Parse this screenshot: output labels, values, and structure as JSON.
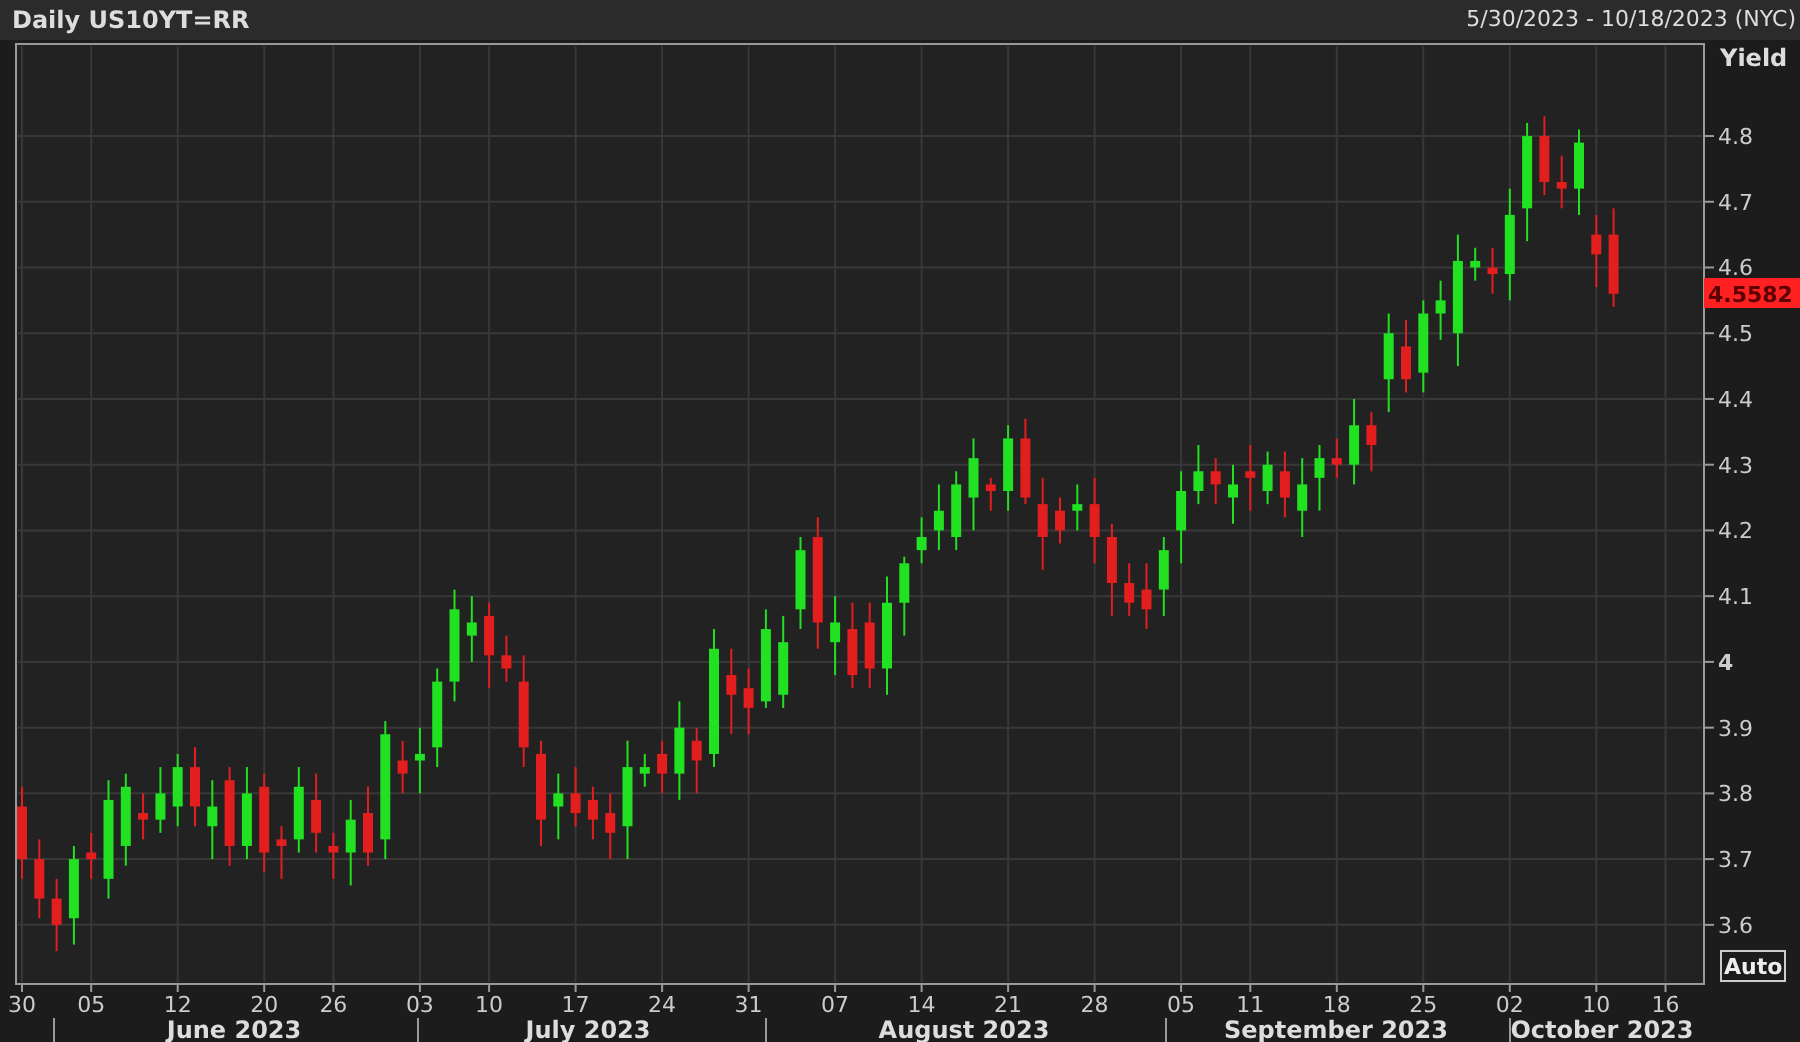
{
  "header": {
    "title": "Daily US10YT=RR",
    "date_range": "5/30/2023 - 10/18/2023 (NYC)"
  },
  "chart": {
    "last_price": "4.5582",
    "auto_button": "Auto",
    "month_labels": [
      "June 2023",
      "July 2023",
      "August 2023",
      "September 2023",
      "October 2023"
    ],
    "chart_data": {
      "type": "candlestick",
      "ylabel": "Yield",
      "ylim": [
        3.51,
        4.94
      ],
      "grid": true,
      "yticks": [
        4.8,
        4.7,
        4.6,
        4.5,
        4.4,
        4.3,
        4.2,
        4.1,
        4,
        3.9,
        3.8,
        3.7,
        3.6
      ],
      "categories": [
        "30",
        null,
        null,
        null,
        "05",
        null,
        null,
        null,
        null,
        "12",
        null,
        null,
        null,
        null,
        "20",
        null,
        null,
        null,
        "26",
        null,
        null,
        null,
        null,
        "03",
        null,
        null,
        null,
        "10",
        null,
        null,
        null,
        null,
        "17",
        null,
        null,
        null,
        null,
        "24",
        null,
        null,
        null,
        null,
        "31",
        null,
        null,
        null,
        null,
        "07",
        null,
        null,
        null,
        null,
        "14",
        null,
        null,
        null,
        null,
        "21",
        null,
        null,
        null,
        null,
        "28",
        null,
        null,
        null,
        null,
        "05",
        null,
        null,
        null,
        "11",
        null,
        null,
        null,
        null,
        "18",
        null,
        null,
        null,
        null,
        "25",
        null,
        null,
        null,
        null,
        "02",
        null,
        null,
        null,
        null,
        "10",
        null,
        null,
        null,
        "16"
      ],
      "ohlc": [
        [
          3.78,
          3.81,
          3.67,
          3.7
        ],
        [
          3.7,
          3.73,
          3.61,
          3.64
        ],
        [
          3.64,
          3.67,
          3.56,
          3.6
        ],
        [
          3.61,
          3.72,
          3.57,
          3.7
        ],
        [
          3.71,
          3.74,
          3.67,
          3.7
        ],
        [
          3.67,
          3.82,
          3.64,
          3.79
        ],
        [
          3.72,
          3.83,
          3.69,
          3.81
        ],
        [
          3.77,
          3.8,
          3.73,
          3.76
        ],
        [
          3.76,
          3.84,
          3.74,
          3.8
        ],
        [
          3.78,
          3.86,
          3.75,
          3.84
        ],
        [
          3.84,
          3.87,
          3.75,
          3.78
        ],
        [
          3.75,
          3.82,
          3.7,
          3.78
        ],
        [
          3.82,
          3.84,
          3.69,
          3.72
        ],
        [
          3.72,
          3.84,
          3.7,
          3.8
        ],
        [
          3.81,
          3.83,
          3.68,
          3.71
        ],
        [
          3.73,
          3.75,
          3.67,
          3.72
        ],
        [
          3.73,
          3.84,
          3.71,
          3.81
        ],
        [
          3.79,
          3.83,
          3.71,
          3.74
        ],
        [
          3.72,
          3.74,
          3.67,
          3.71
        ],
        [
          3.71,
          3.79,
          3.66,
          3.76
        ],
        [
          3.77,
          3.81,
          3.69,
          3.71
        ],
        [
          3.73,
          3.91,
          3.7,
          3.89
        ],
        [
          3.85,
          3.88,
          3.8,
          3.83
        ],
        [
          3.85,
          3.9,
          3.8,
          3.86
        ],
        [
          3.87,
          3.99,
          3.84,
          3.97
        ],
        [
          3.97,
          4.11,
          3.94,
          4.08
        ],
        [
          4.04,
          4.1,
          4.0,
          4.06
        ],
        [
          4.07,
          4.09,
          3.96,
          4.01
        ],
        [
          4.01,
          4.04,
          3.97,
          3.99
        ],
        [
          3.97,
          4.01,
          3.84,
          3.87
        ],
        [
          3.86,
          3.88,
          3.72,
          3.76
        ],
        [
          3.78,
          3.83,
          3.73,
          3.8
        ],
        [
          3.8,
          3.84,
          3.75,
          3.77
        ],
        [
          3.79,
          3.81,
          3.73,
          3.76
        ],
        [
          3.77,
          3.8,
          3.7,
          3.74
        ],
        [
          3.75,
          3.88,
          3.7,
          3.84
        ],
        [
          3.83,
          3.86,
          3.81,
          3.84
        ],
        [
          3.86,
          3.88,
          3.8,
          3.83
        ],
        [
          3.83,
          3.94,
          3.79,
          3.9
        ],
        [
          3.88,
          3.9,
          3.8,
          3.85
        ],
        [
          3.86,
          4.05,
          3.84,
          4.02
        ],
        [
          3.98,
          4.02,
          3.89,
          3.95
        ],
        [
          3.96,
          3.99,
          3.89,
          3.93
        ],
        [
          3.94,
          4.08,
          3.93,
          4.05
        ],
        [
          3.95,
          4.07,
          3.93,
          4.03
        ],
        [
          4.08,
          4.19,
          4.05,
          4.17
        ],
        [
          4.19,
          4.22,
          4.02,
          4.06
        ],
        [
          4.03,
          4.1,
          3.98,
          4.06
        ],
        [
          4.05,
          4.09,
          3.96,
          3.98
        ],
        [
          4.06,
          4.09,
          3.96,
          3.99
        ],
        [
          3.99,
          4.13,
          3.95,
          4.09
        ],
        [
          4.09,
          4.16,
          4.04,
          4.15
        ],
        [
          4.17,
          4.22,
          4.15,
          4.19
        ],
        [
          4.2,
          4.27,
          4.17,
          4.23
        ],
        [
          4.19,
          4.29,
          4.17,
          4.27
        ],
        [
          4.25,
          4.34,
          4.2,
          4.31
        ],
        [
          4.27,
          4.28,
          4.23,
          4.26
        ],
        [
          4.26,
          4.36,
          4.23,
          4.34
        ],
        [
          4.34,
          4.37,
          4.24,
          4.25
        ],
        [
          4.24,
          4.28,
          4.14,
          4.19
        ],
        [
          4.23,
          4.25,
          4.18,
          4.2
        ],
        [
          4.23,
          4.27,
          4.2,
          4.24
        ],
        [
          4.24,
          4.28,
          4.15,
          4.19
        ],
        [
          4.19,
          4.21,
          4.07,
          4.12
        ],
        [
          4.12,
          4.15,
          4.07,
          4.09
        ],
        [
          4.11,
          4.15,
          4.05,
          4.08
        ],
        [
          4.11,
          4.19,
          4.07,
          4.17
        ],
        [
          4.2,
          4.29,
          4.15,
          4.26
        ],
        [
          4.26,
          4.33,
          4.24,
          4.29
        ],
        [
          4.29,
          4.31,
          4.24,
          4.27
        ],
        [
          4.25,
          4.3,
          4.21,
          4.27
        ],
        [
          4.29,
          4.33,
          4.23,
          4.28
        ],
        [
          4.26,
          4.32,
          4.24,
          4.3
        ],
        [
          4.29,
          4.32,
          4.22,
          4.25
        ],
        [
          4.23,
          4.31,
          4.19,
          4.27
        ],
        [
          4.28,
          4.33,
          4.23,
          4.31
        ],
        [
          4.31,
          4.34,
          4.28,
          4.3
        ],
        [
          4.3,
          4.4,
          4.27,
          4.36
        ],
        [
          4.36,
          4.38,
          4.29,
          4.33
        ],
        [
          4.43,
          4.53,
          4.38,
          4.5
        ],
        [
          4.48,
          4.52,
          4.41,
          4.43
        ],
        [
          4.44,
          4.55,
          4.41,
          4.53
        ],
        [
          4.53,
          4.58,
          4.49,
          4.55
        ],
        [
          4.5,
          4.65,
          4.45,
          4.61
        ],
        [
          4.6,
          4.63,
          4.58,
          4.61
        ],
        [
          4.6,
          4.63,
          4.56,
          4.59
        ],
        [
          4.59,
          4.72,
          4.55,
          4.68
        ],
        [
          4.69,
          4.82,
          4.64,
          4.8
        ],
        [
          4.8,
          4.83,
          4.71,
          4.73
        ],
        [
          4.73,
          4.77,
          4.69,
          4.72
        ],
        [
          4.72,
          4.81,
          4.68,
          4.79
        ],
        [
          4.65,
          4.68,
          4.57,
          4.62
        ],
        [
          4.65,
          4.69,
          4.54,
          4.56
        ],
        null,
        null,
        null
      ]
    }
  }
}
